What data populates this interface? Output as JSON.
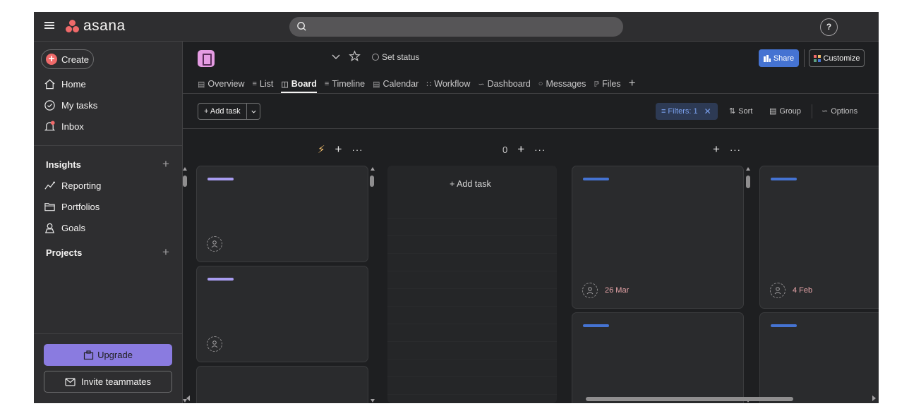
{
  "topbar": {
    "logo_text": "asana",
    "help_label": "?"
  },
  "sidebar": {
    "create_label": "Create",
    "nav": [
      {
        "label": "Home",
        "icon": "home-icon"
      },
      {
        "label": "My tasks",
        "icon": "check-circle-icon"
      },
      {
        "label": "Inbox",
        "icon": "bell-icon"
      }
    ],
    "insights_label": "Insights",
    "insights_items": [
      {
        "label": "Reporting",
        "icon": "chart-line-icon"
      },
      {
        "label": "Portfolios",
        "icon": "folder-icon"
      },
      {
        "label": "Goals",
        "icon": "person-icon"
      }
    ],
    "projects_label": "Projects",
    "upgrade_label": "Upgrade",
    "invite_label": "Invite teammates"
  },
  "project": {
    "set_status_label": "Set status",
    "share_label": "Share",
    "customize_label": "Customize",
    "tabs": [
      {
        "label": "Overview",
        "icon": "overview-icon"
      },
      {
        "label": "List",
        "icon": "list-icon"
      },
      {
        "label": "Board",
        "icon": "board-icon",
        "active": true
      },
      {
        "label": "Timeline",
        "icon": "timeline-icon"
      },
      {
        "label": "Calendar",
        "icon": "calendar-icon"
      },
      {
        "label": "Workflow",
        "icon": "workflow-icon"
      },
      {
        "label": "Dashboard",
        "icon": "dashboard-icon"
      },
      {
        "label": "Messages",
        "icon": "message-icon"
      },
      {
        "label": "Files",
        "icon": "paperclip-icon"
      }
    ]
  },
  "toolbar": {
    "add_task_label": "+ Add task",
    "filters_label": "Filters: 1",
    "sort_label": "Sort",
    "group_label": "Group",
    "options_label": "Options"
  },
  "board": {
    "column2_count": "0",
    "column2_add_task": "+ Add task",
    "cards": {
      "col3_card1_due": "26 Mar",
      "col4_card1_due": "4 Feb"
    },
    "colors": {
      "purple_bar": "#a89cf0",
      "blue_bar": "#4573d2",
      "due_text": "#e8a5a9"
    }
  }
}
